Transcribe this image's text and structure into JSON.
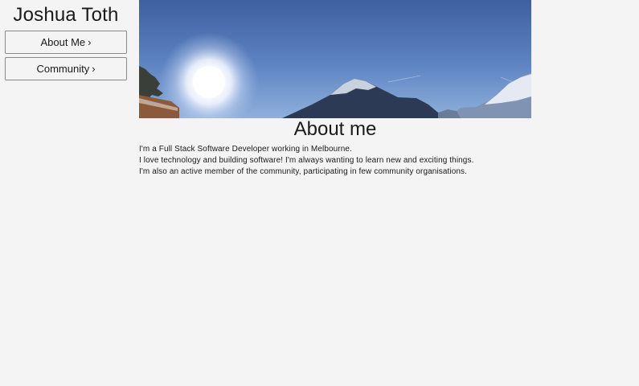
{
  "sidebar": {
    "site_name": "Joshua Toth",
    "nav": [
      {
        "label": "About Me",
        "chevron": "›"
      },
      {
        "label": "Community",
        "chevron": "›"
      }
    ]
  },
  "main": {
    "hero_image": "mountain-landscape-banner",
    "heading": "About me",
    "paragraphs": [
      "I'm a Full Stack Software Developer working in Melbourne.",
      "I love technology and building software! I'm always wanting to learn new and exciting things.",
      "I'm also an active member of the community, participating in few community organisations."
    ]
  },
  "colors": {
    "background": "#f4f4f4",
    "text": "#1a1a1a",
    "button_border": "#8a8a8a",
    "sky_top": "#3d5f9e",
    "sky_bottom": "#86a9d8"
  }
}
